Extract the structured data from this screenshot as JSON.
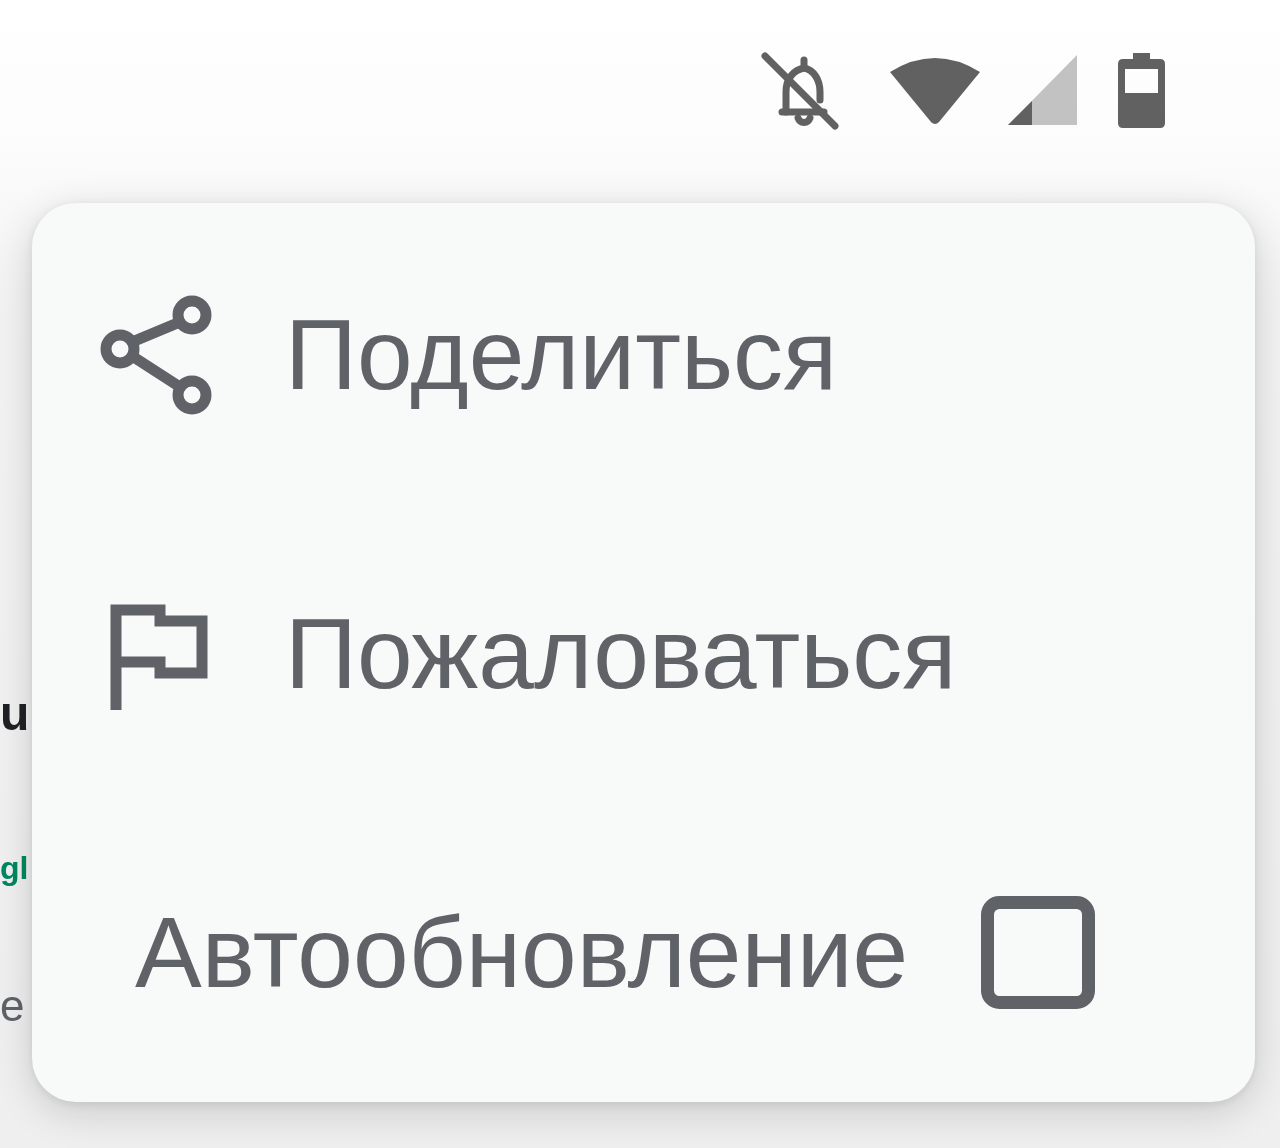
{
  "page_behind": {
    "line_1": "u",
    "line_2": "gl",
    "line_3": "e"
  },
  "menu": {
    "items": [
      {
        "kind": "share",
        "label": "Поделиться"
      },
      {
        "kind": "report",
        "label": "Пожаловаться"
      },
      {
        "kind": "checkbox",
        "label": "Автообновление",
        "checked": false
      }
    ]
  }
}
